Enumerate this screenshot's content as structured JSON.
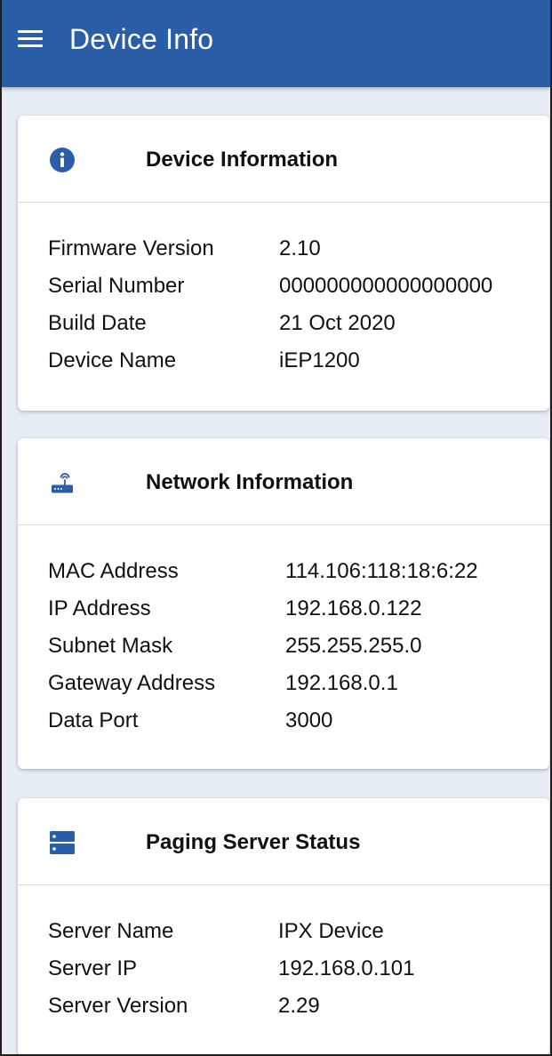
{
  "app": {
    "title": "Device Info"
  },
  "colors": {
    "appbar": "#2c5ea8",
    "icon": "#2c5ea8",
    "background": "#e7edf5"
  },
  "device_info": {
    "title": "Device Information",
    "icon": "info-icon",
    "rows": [
      {
        "label": "Firmware Version",
        "value": "2.10"
      },
      {
        "label": "Serial Number",
        "value": "000000000000000000"
      },
      {
        "label": "Build Date",
        "value": "21 Oct 2020"
      },
      {
        "label": "Device Name",
        "value": "iEP1200"
      }
    ]
  },
  "network_info": {
    "title": "Network Information",
    "icon": "router-icon",
    "rows": [
      {
        "label": "MAC Address",
        "value": "114.106:118:18:6:22"
      },
      {
        "label": "IP Address",
        "value": "192.168.0.122"
      },
      {
        "label": "Subnet Mask",
        "value": "255.255.255.0"
      },
      {
        "label": "Gateway Address",
        "value": "192.168.0.1"
      },
      {
        "label": "Data Port",
        "value": "3000"
      }
    ]
  },
  "paging_server": {
    "title": "Paging Server Status",
    "icon": "server-icon",
    "rows": [
      {
        "label": "Server Name",
        "value": "IPX Device"
      },
      {
        "label": "Server IP",
        "value": "192.168.0.101"
      },
      {
        "label": "Server Version",
        "value": "2.29"
      }
    ]
  }
}
